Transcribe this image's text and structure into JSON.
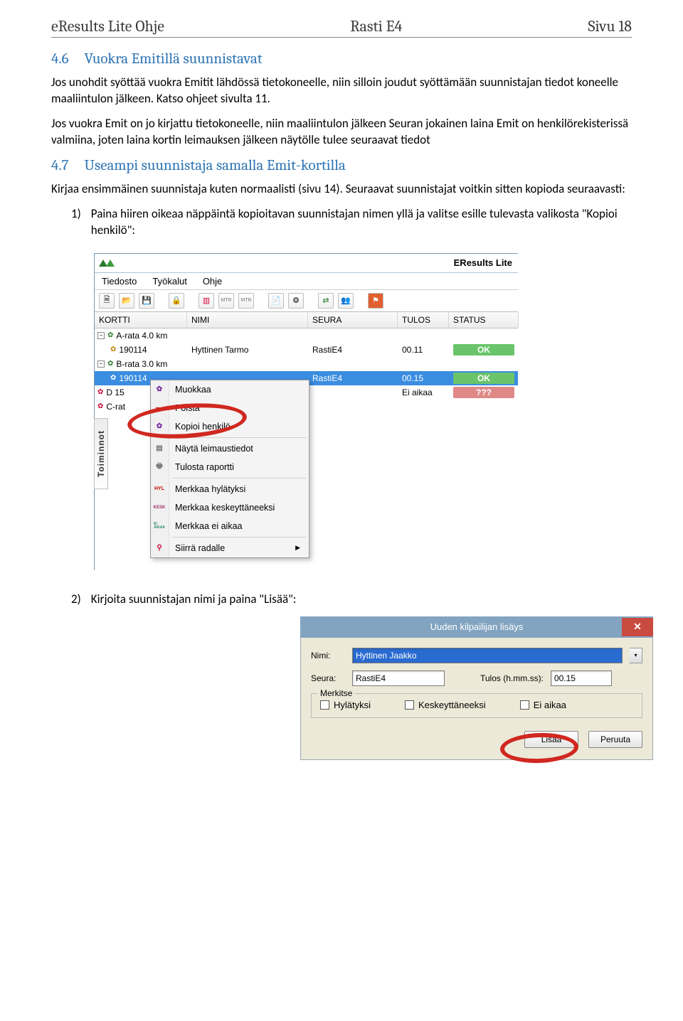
{
  "header": {
    "left": "eResults Lite Ohje",
    "center": "Rasti E4",
    "right": "Sivu 18"
  },
  "s46": {
    "num": "4.6",
    "title": "Vuokra Emitillä suunnistavat",
    "p1": "Jos unohdit syöttää vuokra Emitit lähdössä tietokoneelle, niin silloin joudut syöttämään suunnistajan tiedot koneelle maaliintulon jälkeen. Katso ohjeet sivulta 11.",
    "p2": "Jos vuokra Emit on jo kirjattu tietokoneelle, niin maaliintulon jälkeen Seuran jokainen laina Emit on henkilörekisterissä valmiina, joten laina kortin leimauksen jälkeen näytölle tulee seuraavat tiedot"
  },
  "s47": {
    "num": "4.7",
    "title": "Useampi suunnistaja samalla Emit-kortilla",
    "p1": "Kirjaa ensimmäinen suunnistaja kuten normaalisti (sivu 14). Seuraavat suunnistajat voitkin sitten kopioda seuraavasti:",
    "li1_num": "1)",
    "li1_text": "Paina hiiren oikeaa näppäintä kopioitavan suunnistajan nimen yllä ja valitse esille tulevasta valikosta \"Kopioi henkilö\":",
    "li2_num": "2)",
    "li2_text": "Kirjoita suunnistajan nimi ja paina \"Lisää\":"
  },
  "shot1": {
    "title": "EResults Lite",
    "menu": {
      "file": "Tiedosto",
      "tools": "Työkalut",
      "help": "Ohje"
    },
    "cols": {
      "kortti": "KORTTI",
      "nimi": "NIMI",
      "seura": "SEURA",
      "tulos": "TULOS",
      "status": "STATUS"
    },
    "rows": {
      "a_label": "A-rata 4.0 km",
      "a_card": "190114",
      "a_name": "Hyttinen Tarmo",
      "a_club": "RastiE4",
      "a_time": "00.11",
      "a_status": "OK",
      "b_label": "B-rata 3.0 km",
      "b_card": "190114",
      "b_club": "RastiE4",
      "b_time": "00.15",
      "b_status": "OK",
      "d_label": "D 15",
      "d_status_text": "Ei aikaa",
      "d_status_badge": "???",
      "c_label": "C-rat"
    },
    "ctx": {
      "muokkaa": "Muokkaa",
      "poista": "Poista",
      "kopioi": "Kopioi henkilö",
      "nayta": "Näytä leimaustiedot",
      "tulosta": "Tulosta raportti",
      "hyl": "Merkkaa hylätyksi",
      "kesk": "Merkkaa keskeyttäneeksi",
      "eiaikaa": "Merkkaa ei aikaa",
      "siirra": "Siirrä radalle",
      "icon_hyl": "HYL",
      "icon_kesk": "KESK",
      "icon_ei": "EI\nAIKAA"
    },
    "side_tab": "Toiminnot"
  },
  "shot2": {
    "title": "Uuden kilpailijan lisäys",
    "nimi_label": "Nimi:",
    "nimi_val": "Hyttinen Jaakko",
    "seura_label": "Seura:",
    "seura_val": "RastiE4",
    "tulos_label": "Tulos (h.mm.ss):",
    "tulos_val": "00.15",
    "merkitse": "Merkitse",
    "hyl": "Hylätyksi",
    "kesk": "Keskeyttäneeksi",
    "eiaikaa": "Ei aikaa",
    "lisaa": "Lisää",
    "peruuta": "Peruuta"
  }
}
